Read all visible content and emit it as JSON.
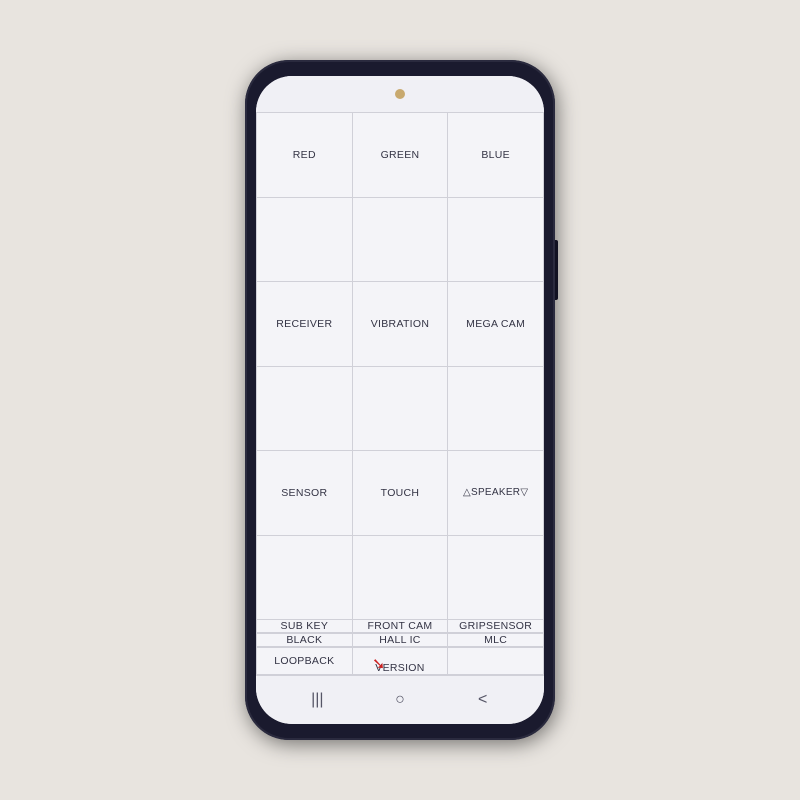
{
  "background": {
    "color": "#e8e4df"
  },
  "phone": {
    "camera_dot": "camera",
    "grid": {
      "rows": [
        [
          {
            "label": "RED",
            "id": "red"
          },
          {
            "label": "GREEN",
            "id": "green"
          },
          {
            "label": "BLUE",
            "id": "blue"
          }
        ],
        [
          {
            "label": "",
            "id": "empty1"
          },
          {
            "label": "",
            "id": "empty2"
          },
          {
            "label": "",
            "id": "empty3"
          }
        ],
        [
          {
            "label": "RECEIVER",
            "id": "receiver"
          },
          {
            "label": "VIBRATION",
            "id": "vibration"
          },
          {
            "label": "MEGA CAM",
            "id": "mega-cam"
          }
        ],
        [
          {
            "label": "",
            "id": "empty4"
          },
          {
            "label": "",
            "id": "empty5"
          },
          {
            "label": "",
            "id": "empty6"
          }
        ],
        [
          {
            "label": "SENSOR",
            "id": "sensor"
          },
          {
            "label": "TOUCH",
            "id": "touch"
          },
          {
            "label": "△SPEAKER▽",
            "id": "speaker",
            "special": true
          }
        ],
        [
          {
            "label": "",
            "id": "empty7"
          },
          {
            "label": "",
            "id": "empty8"
          },
          {
            "label": "",
            "id": "empty9"
          }
        ],
        [
          {
            "label": "SUB KEY",
            "id": "sub-key"
          },
          {
            "label": "FRONT CAM",
            "id": "front-cam"
          },
          {
            "label": "GRIPSENSOR",
            "id": "gripsensor"
          }
        ],
        [
          {
            "label": "",
            "id": "empty10"
          },
          {
            "label": "",
            "id": "empty11"
          },
          {
            "label": "",
            "id": "empty12"
          }
        ],
        [
          {
            "label": "BLACK",
            "id": "black"
          },
          {
            "label": "HALL IC",
            "id": "hall-ic"
          },
          {
            "label": "MLC",
            "id": "mlc"
          }
        ],
        [
          {
            "label": "",
            "id": "empty13"
          },
          {
            "label": "",
            "id": "empty14"
          },
          {
            "label": "",
            "id": "empty15"
          }
        ],
        [
          {
            "label": "LOOPBACK",
            "id": "loopback"
          },
          {
            "label": "VERSION",
            "id": "version",
            "arrow": true
          },
          {
            "label": "",
            "id": "empty16"
          }
        ],
        [
          {
            "label": "",
            "id": "empty17"
          },
          {
            "label": "",
            "id": "empty18"
          },
          {
            "label": "",
            "id": "empty19"
          }
        ]
      ]
    },
    "nav": {
      "recents_icon": "|||",
      "home_icon": "○",
      "back_icon": "<"
    }
  }
}
